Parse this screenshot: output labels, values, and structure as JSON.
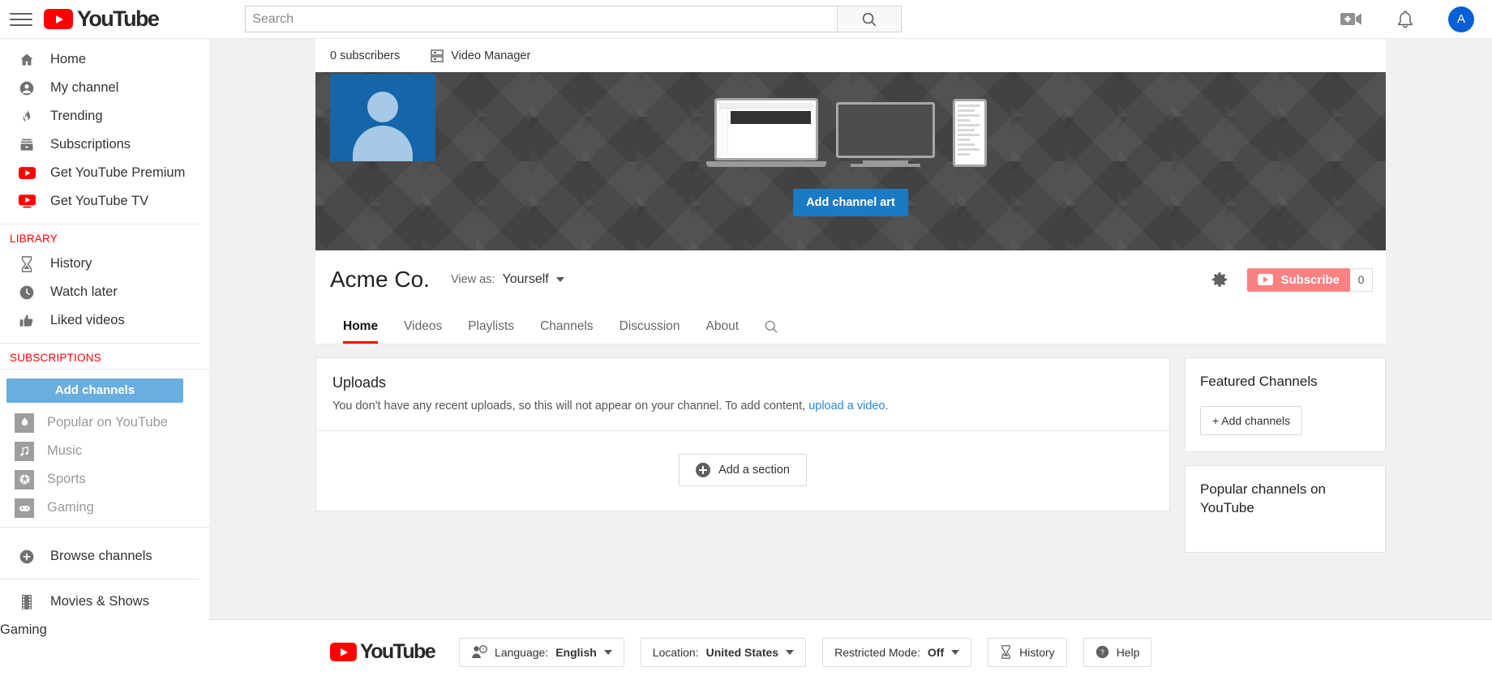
{
  "masthead": {
    "menu_icon": "hamburger-icon",
    "logo_text": "YouTube",
    "search": {
      "value": "",
      "placeholder": "Search"
    },
    "search_button_icon": "search-icon",
    "upload_icon": "video-camera-add-icon",
    "notifications_icon": "bell-icon",
    "avatar_letter": "A"
  },
  "sidebar": {
    "primary": [
      {
        "label": "Home",
        "icon": "home-icon"
      },
      {
        "label": "My channel",
        "icon": "account-circle-icon"
      },
      {
        "label": "Trending",
        "icon": "flame-icon"
      },
      {
        "label": "Subscriptions",
        "icon": "subscriptions-icon"
      },
      {
        "label": "Get YouTube Premium",
        "icon": "youtube-premium-icon"
      },
      {
        "label": "Get YouTube TV",
        "icon": "youtube-tv-icon"
      }
    ],
    "library_title": "LIBRARY",
    "library": [
      {
        "label": "History",
        "icon": "hourglass-icon"
      },
      {
        "label": "Watch later",
        "icon": "clock-icon"
      },
      {
        "label": "Liked videos",
        "icon": "thumbs-up-icon"
      }
    ],
    "subscriptions_title": "SUBSCRIPTIONS",
    "add_channels_label": "Add channels",
    "channels": [
      {
        "label": "Popular on YouTube",
        "icon": "popular-thumb-icon"
      },
      {
        "label": "Music",
        "icon": "music-note-thumb-icon"
      },
      {
        "label": "Sports",
        "icon": "soccer-ball-thumb-icon"
      },
      {
        "label": "Gaming",
        "icon": "gamepad-thumb-icon"
      }
    ],
    "browse": {
      "label": "Browse channels",
      "icon": "plus-circle-icon"
    },
    "more": [
      {
        "label": "Movies & Shows",
        "icon": "film-icon"
      },
      {
        "label": "Gaming",
        "icon": ""
      }
    ]
  },
  "channel": {
    "subscribers_text": "0 subscribers",
    "video_manager_label": "Video Manager",
    "video_manager_icon": "video-manager-icon",
    "banner": {
      "add_channel_art_label": "Add channel art",
      "avatar_icon": "default-person-avatar",
      "devices": [
        "laptop",
        "tv",
        "phone"
      ]
    },
    "title": "Acme Co.",
    "view_as_label": "View as:",
    "view_as_value": "Yourself",
    "settings_icon": "gear-icon",
    "subscribe_label": "Subscribe",
    "subscribe_count": "0",
    "tabs": [
      {
        "label": "Home",
        "active": true
      },
      {
        "label": "Videos",
        "active": false
      },
      {
        "label": "Playlists",
        "active": false
      },
      {
        "label": "Channels",
        "active": false
      },
      {
        "label": "Discussion",
        "active": false
      },
      {
        "label": "About",
        "active": false
      }
    ],
    "tab_search_icon": "search-icon"
  },
  "main": {
    "uploads_title": "Uploads",
    "uploads_text_before": "You don't have any recent uploads, so this will not appear on your channel. To add content, ",
    "uploads_link": "upload a video",
    "uploads_text_after": ".",
    "add_section_label": "Add a section"
  },
  "right_rail": {
    "featured_title": "Featured Channels",
    "featured_add_label": "+ Add channels",
    "popular_title": "Popular channels on YouTube"
  },
  "footer": {
    "logo_text": "YouTube",
    "language": {
      "prefix": "Language:",
      "value": "English",
      "icon": "language-person-icon"
    },
    "location": {
      "prefix": "Location:",
      "value": "United States"
    },
    "restricted": {
      "prefix": "Restricted Mode:",
      "value": "Off"
    },
    "history": {
      "label": "History",
      "icon": "hourglass-icon"
    },
    "help": {
      "label": "Help",
      "icon": "help-circle-icon"
    }
  },
  "colors": {
    "brand_red": "#ff0000",
    "link_blue": "#2b87d4",
    "subscribe_salmon": "#f98181",
    "add_channels_blue": "#6aaee0",
    "add_art_blue": "#1a7ac4",
    "avatar_blue": "#065fd4"
  }
}
